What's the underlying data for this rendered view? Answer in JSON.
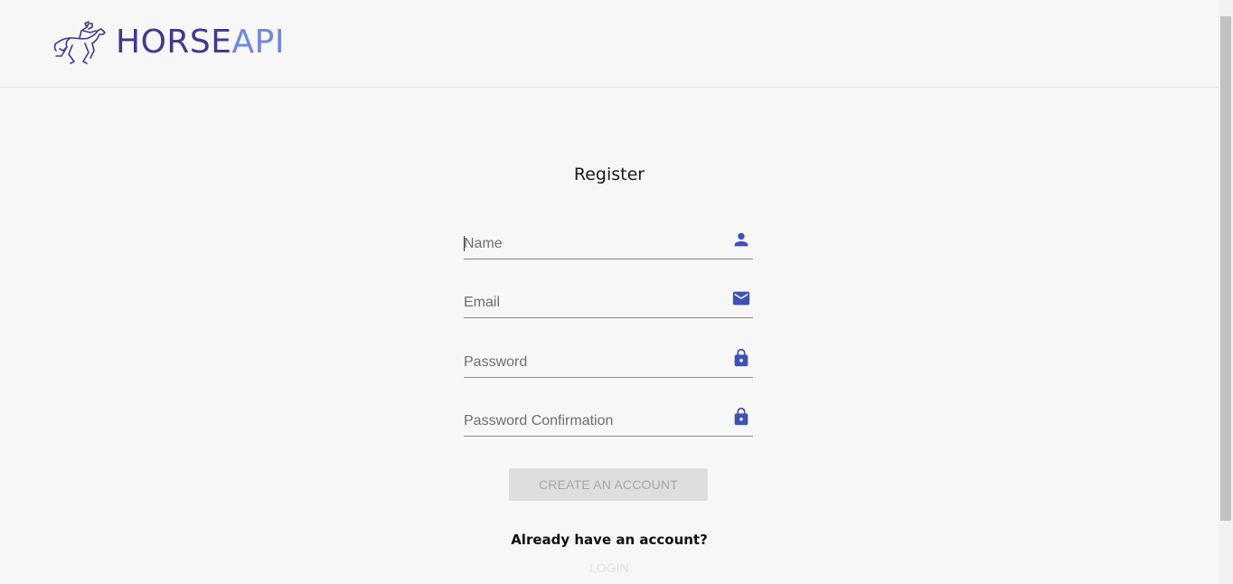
{
  "header": {
    "logo": {
      "text_part1": "HORSE",
      "text_part2": "API",
      "icon": "horse-jockey-icon"
    }
  },
  "form": {
    "title": "Register",
    "fields": [
      {
        "placeholder": "Name",
        "value": "",
        "icon": "person-icon"
      },
      {
        "placeholder": "Email",
        "value": "",
        "icon": "envelope-icon"
      },
      {
        "placeholder": "Password",
        "value": "",
        "icon": "lock-icon"
      },
      {
        "placeholder": "Password Confirmation",
        "value": "",
        "icon": "lock-icon"
      }
    ],
    "submit_label": "CREATE AN ACCOUNT",
    "already_text": "Already have an account?",
    "login_label": "LOGIN"
  },
  "colors": {
    "brand_dark": "#3f3b8c",
    "brand_light": "#6f87e0",
    "icon": "#3f51b5",
    "background": "#f7f7f7",
    "button_disabled_bg": "#dedede",
    "button_disabled_text": "#a6a6a6"
  }
}
